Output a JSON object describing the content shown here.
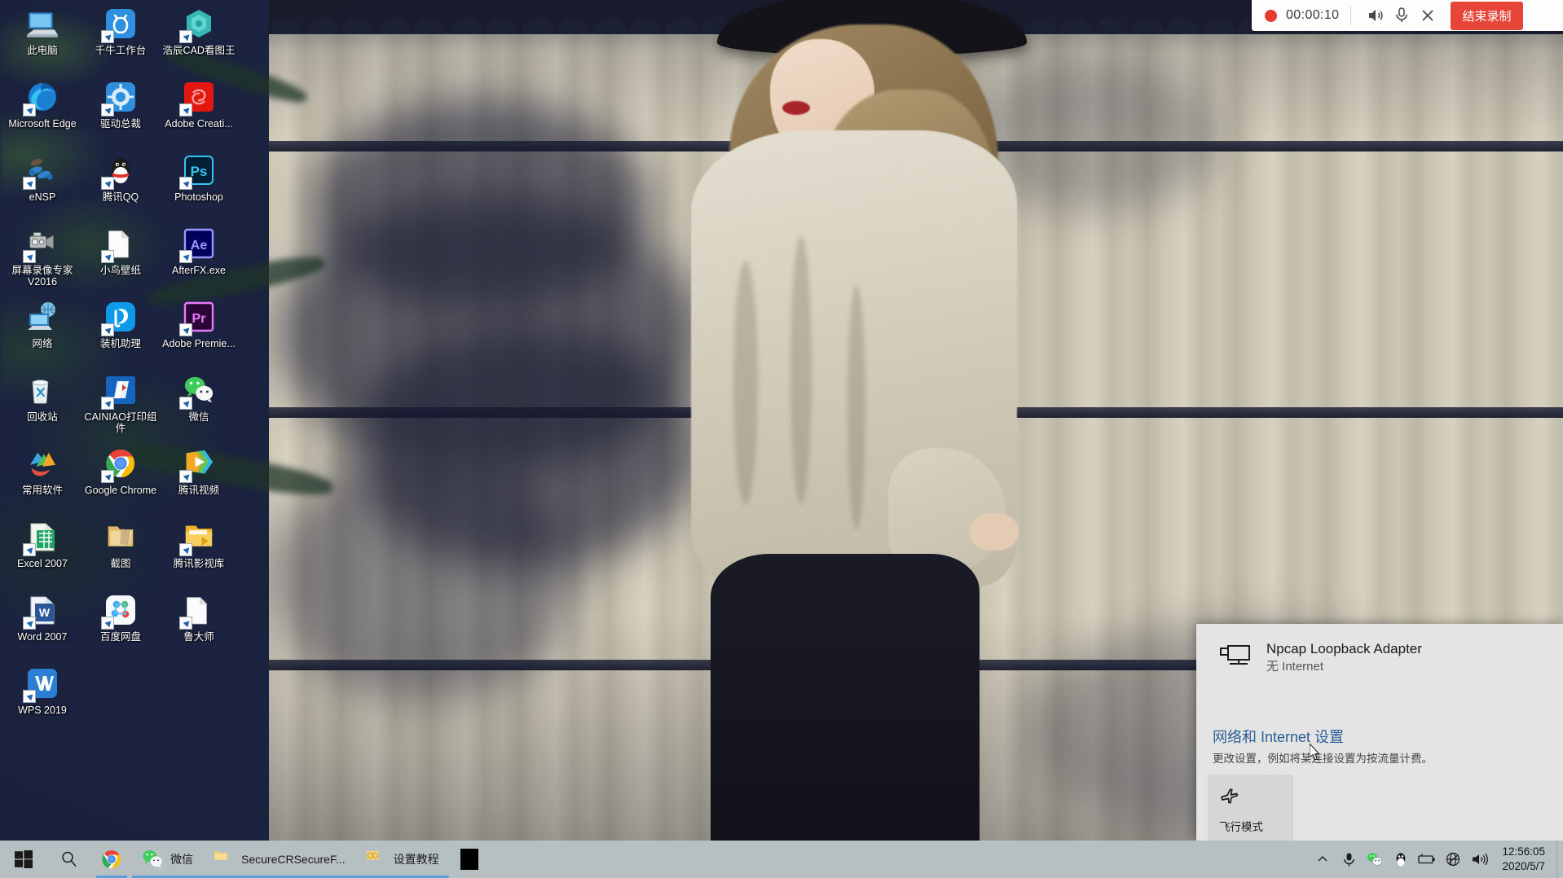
{
  "desktop": {
    "icons": [
      {
        "label": "此电脑",
        "icon": "this-pc-icon",
        "shortcut": false
      },
      {
        "label": "千牛工作台",
        "icon": "qianniu-icon",
        "shortcut": true
      },
      {
        "label": "浩辰CAD看图王",
        "icon": "gstarcad-viewer-icon",
        "shortcut": true
      },
      {
        "label": "Microsoft Edge",
        "icon": "microsoft-edge-icon",
        "shortcut": true
      },
      {
        "label": "驱动总裁",
        "icon": "drive-master-icon",
        "shortcut": true
      },
      {
        "label": "Adobe Creati...",
        "icon": "adobe-creative-cloud-icon",
        "shortcut": true
      },
      {
        "label": "eNSP",
        "icon": "ensp-icon",
        "shortcut": true
      },
      {
        "label": "腾讯QQ",
        "icon": "tencent-qq-icon",
        "shortcut": true
      },
      {
        "label": "Photoshop",
        "icon": "photoshop-icon",
        "shortcut": true
      },
      {
        "label": "屏幕录像专家V2016",
        "icon": "screen-recorder-icon",
        "shortcut": true
      },
      {
        "label": "小鸟壁纸",
        "icon": "blank-document-icon",
        "shortcut": true
      },
      {
        "label": "AfterFX.exe",
        "icon": "after-effects-icon",
        "shortcut": true
      },
      {
        "label": "网络",
        "icon": "network-icon",
        "shortcut": false
      },
      {
        "label": "装机助理",
        "icon": "install-assistant-icon",
        "shortcut": true
      },
      {
        "label": "Adobe Premie...",
        "icon": "premiere-pro-icon",
        "shortcut": true
      },
      {
        "label": "回收站",
        "icon": "recycle-bin-icon",
        "shortcut": false
      },
      {
        "label": "CAINIAO打印组件",
        "icon": "cainiao-print-icon",
        "shortcut": true
      },
      {
        "label": "微信",
        "icon": "wechat-icon",
        "shortcut": true
      },
      {
        "label": "常用软件",
        "icon": "common-software-folder-icon",
        "shortcut": false
      },
      {
        "label": "Google Chrome",
        "icon": "google-chrome-icon",
        "shortcut": true
      },
      {
        "label": "腾讯视频",
        "icon": "tencent-video-icon",
        "shortcut": true
      },
      {
        "label": "Excel 2007",
        "icon": "excel-icon",
        "shortcut": true
      },
      {
        "label": "截图",
        "icon": "screenshot-folder-icon",
        "shortcut": false
      },
      {
        "label": "腾讯影视库",
        "icon": "tencent-media-folder-icon",
        "shortcut": true
      },
      {
        "label": "Word 2007",
        "icon": "word-icon",
        "shortcut": true
      },
      {
        "label": "百度网盘",
        "icon": "baidu-netdisk-icon",
        "shortcut": true
      },
      {
        "label": "鲁大师",
        "icon": "blank-document-icon",
        "shortcut": true
      },
      {
        "label": "WPS 2019",
        "icon": "wps-office-icon",
        "shortcut": true
      }
    ]
  },
  "recording_bar": {
    "elapsed": "00:00:10",
    "stop_label": "结束录制",
    "speaker_icon": "speaker-icon",
    "microphone_icon": "microphone-icon",
    "close_icon": "close-icon",
    "record_dot_color": "#e8392e",
    "stop_button_color": "#e8453a"
  },
  "network_flyout": {
    "adapter_name": "Npcap Loopback Adapter",
    "adapter_status": "无 Internet",
    "adapter_icon": "ethernet-adapter-icon",
    "settings_link": "网络和 Internet 设置",
    "settings_link_color": "#2b5f94",
    "settings_description": "更改设置，例如将某连接设置为按流量计费。",
    "airplane_mode_label": "飞行模式",
    "airplane_mode_icon": "airplane-icon"
  },
  "taskbar": {
    "start_icon": "windows-start-icon",
    "search_icon": "search-icon",
    "items": [
      {
        "label": "",
        "icon": "google-chrome-icon",
        "running": true,
        "wide": false
      },
      {
        "label": "微信",
        "icon": "wechat-icon",
        "running": true,
        "wide": true
      },
      {
        "label": "SecureCRSecureF...",
        "icon": "folder-icon",
        "running": true,
        "wide": true
      },
      {
        "label": "设置教程",
        "icon": "folder-yellow-icon",
        "running": true,
        "wide": true
      },
      {
        "label": "",
        "icon": "black-window-icon",
        "running": false,
        "wide": false
      }
    ],
    "tray": [
      {
        "icon": "chevron-up-icon",
        "name": "show-hidden-icons"
      },
      {
        "icon": "microphone-icon",
        "name": "microphone-tray"
      },
      {
        "icon": "wechat-icon",
        "name": "wechat-tray"
      },
      {
        "icon": "qq-penguin-icon",
        "name": "qq-tray"
      },
      {
        "icon": "battery-icon",
        "name": "battery-tray"
      },
      {
        "icon": "network-globe-icon",
        "name": "network-tray"
      },
      {
        "icon": "volume-icon",
        "name": "volume-tray"
      }
    ],
    "clock": {
      "time": "12:56:05",
      "date": "2020/5/7"
    }
  }
}
